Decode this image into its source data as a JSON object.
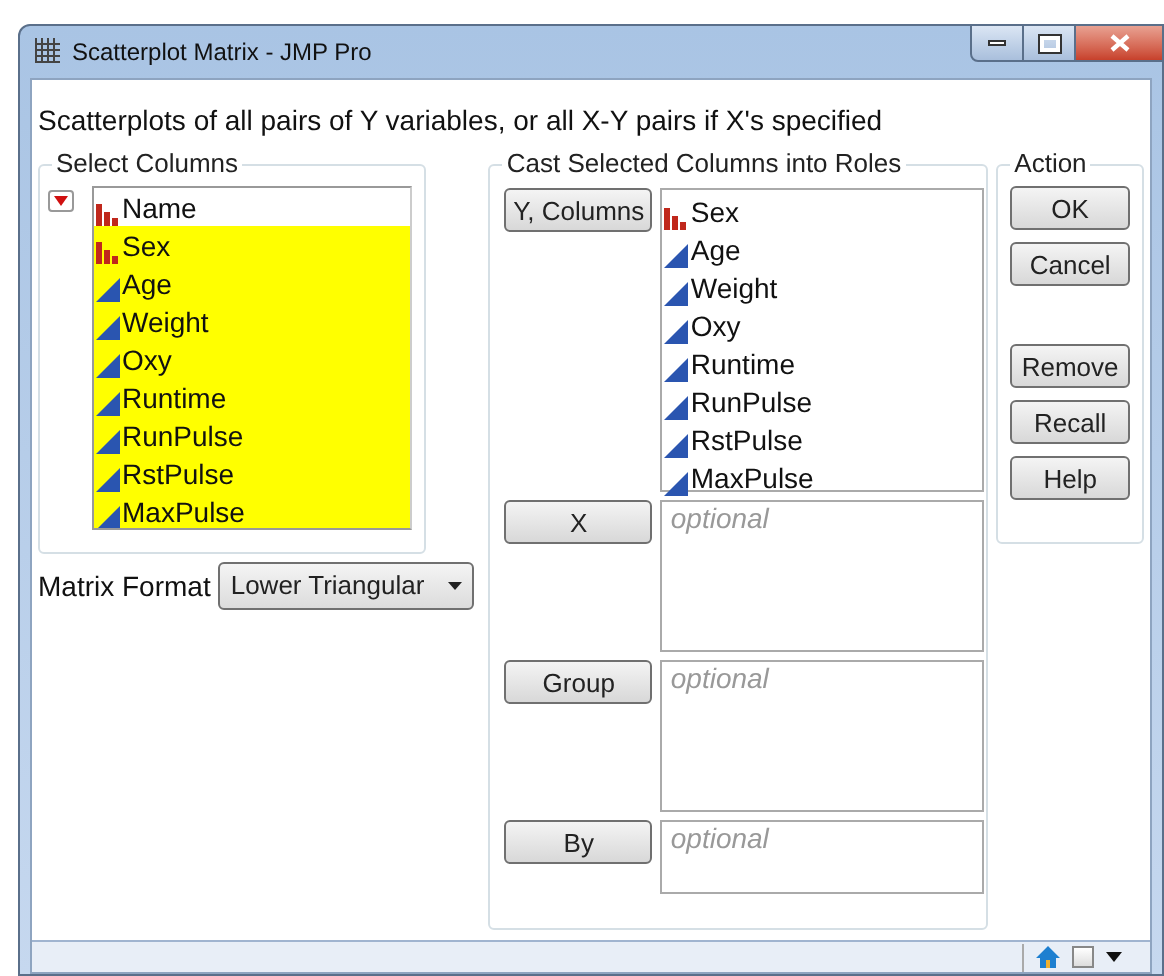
{
  "window": {
    "title": "Scatterplot Matrix - JMP Pro"
  },
  "description": "Scatterplots of all pairs of Y variables, or all X-Y pairs if X's specified",
  "select_columns": {
    "title": "Select Columns",
    "columns": [
      {
        "name": "Name",
        "kind": "nominal",
        "selected": false
      },
      {
        "name": "Sex",
        "kind": "nominal",
        "selected": true
      },
      {
        "name": "Age",
        "kind": "continuous",
        "selected": true
      },
      {
        "name": "Weight",
        "kind": "continuous",
        "selected": true
      },
      {
        "name": "Oxy",
        "kind": "continuous",
        "selected": true
      },
      {
        "name": "Runtime",
        "kind": "continuous",
        "selected": true
      },
      {
        "name": "RunPulse",
        "kind": "continuous",
        "selected": true
      },
      {
        "name": "RstPulse",
        "kind": "continuous",
        "selected": true
      },
      {
        "name": "MaxPulse",
        "kind": "continuous",
        "selected": true
      }
    ]
  },
  "matrix_format": {
    "label": "Matrix Format",
    "value": "Lower Triangular"
  },
  "cast_roles": {
    "title": "Cast Selected Columns into Roles",
    "roles": [
      {
        "button": "Y, Columns",
        "columns": [
          {
            "name": "Sex",
            "kind": "nominal"
          },
          {
            "name": "Age",
            "kind": "continuous"
          },
          {
            "name": "Weight",
            "kind": "continuous"
          },
          {
            "name": "Oxy",
            "kind": "continuous"
          },
          {
            "name": "Runtime",
            "kind": "continuous"
          },
          {
            "name": "RunPulse",
            "kind": "continuous"
          },
          {
            "name": "RstPulse",
            "kind": "continuous"
          },
          {
            "name": "MaxPulse",
            "kind": "continuous"
          }
        ]
      },
      {
        "button": "X",
        "placeholder": "optional"
      },
      {
        "button": "Group",
        "placeholder": "optional"
      },
      {
        "button": "By",
        "placeholder": "optional"
      }
    ]
  },
  "status_bar": {
    "checkbox_checked": false
  },
  "action": {
    "title": "Action",
    "groups": [
      [
        "OK",
        "Cancel"
      ],
      [
        "Remove",
        "Recall",
        "Help"
      ]
    ]
  }
}
